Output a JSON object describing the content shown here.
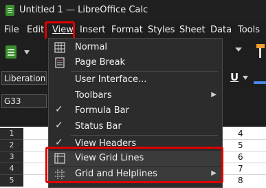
{
  "window": {
    "title": "Untitled 1 — LibreOffice Calc"
  },
  "menubar": {
    "items": [
      {
        "label": "File"
      },
      {
        "label": "Edit"
      },
      {
        "label": "View"
      },
      {
        "label": "Insert"
      },
      {
        "label": "Format"
      },
      {
        "label": "Styles"
      },
      {
        "label": "Sheet"
      },
      {
        "label": "Data"
      },
      {
        "label": "Tools"
      }
    ],
    "open_menu": "View"
  },
  "formatting": {
    "font_name": "Liberation Sans",
    "underline_label": "U"
  },
  "namebox": {
    "value": "G33"
  },
  "grid": {
    "rows": [
      "1",
      "2",
      "3",
      "4",
      "5"
    ],
    "values": [
      "4",
      "5",
      "6",
      "7",
      "8"
    ]
  },
  "view_menu": {
    "items": [
      {
        "label": "Normal",
        "icon": "normal-view-icon"
      },
      {
        "label": "Page Break",
        "icon": "page-break-icon"
      },
      {
        "label": "User Interface..."
      },
      {
        "label": "Toolbars",
        "submenu": true
      },
      {
        "label": "Formula Bar",
        "checked": true
      },
      {
        "label": "Status Bar",
        "checked": true
      },
      {
        "label": "View Headers",
        "checked": true
      },
      {
        "label": "View Grid Lines",
        "icon": "grid-lines-icon"
      },
      {
        "label": "Grid and Helplines",
        "icon": "helplines-icon",
        "submenu": true
      }
    ],
    "submenu_arrow": "▶",
    "check_mark": "✓"
  },
  "colors": {
    "annotation": "#e00000",
    "app_accent": "#3a8f2f"
  }
}
